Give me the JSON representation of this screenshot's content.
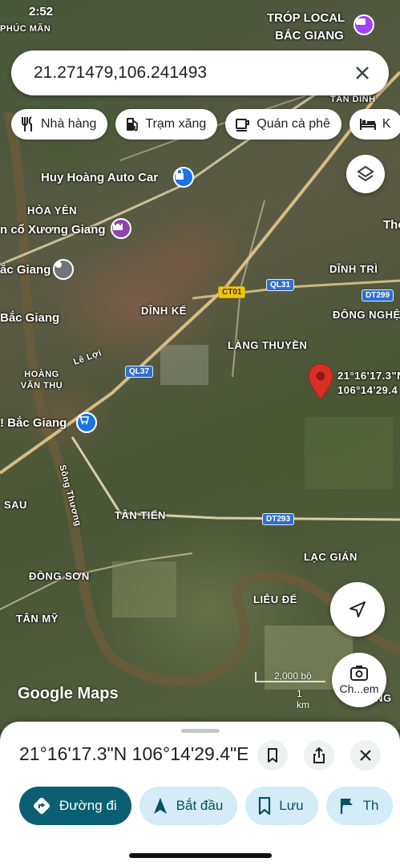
{
  "status": {
    "time": "2:52"
  },
  "search": {
    "query": "21.271479,106.241493"
  },
  "chips": [
    {
      "label": "Nhà hàng",
      "icon": "restaurant-icon"
    },
    {
      "label": "Trạm xăng",
      "icon": "gas-station-icon"
    },
    {
      "label": "Quán cà phê",
      "icon": "coffee-icon"
    },
    {
      "label": "K",
      "icon": "hotel-icon"
    }
  ],
  "map": {
    "labels": {
      "phuc_man": "PHÚC MÃN",
      "trop_local": "TRÓP LOCAL",
      "bac_giang_top": "BẮC GIANG",
      "tan_dinh": "TÂN DĨNH",
      "huy_hoang": "Huy Hoàng Auto Car",
      "hoa_yen": "HÒA YÊN",
      "xuong_giang": "n cổ Xương Giang",
      "tho": "Thọ",
      "bac_giang_city": "ắc Giang",
      "dinh_tri": "DĨNH TRÌ",
      "dinh_ke": "DĨNH KẾ",
      "dong_nghe": "ĐÔNG NGHỆ",
      "bac_giang_left": "Bắc Giang",
      "le_loi": "Lê Lợi",
      "lang_thuyen": "LÀNG THUYỀN",
      "hoang_van_thu": "HOÀNG VĂN THỤ",
      "bac_giang_market": "! Bắc Giang",
      "song_thuong": "Sông Thương",
      "sau": "SAU",
      "tan_tien": "TÂN TIẾN",
      "lac_gian": "LẠC GIÁN",
      "dong_son": "ĐỒNG SƠN",
      "lieu_de": "LIỄU ĐỂ",
      "tan_my": "TÂN MỸ",
      "trung": "TRUNG"
    },
    "shields": {
      "ct01": "CT01",
      "ql31": "QL31",
      "dt299": "DT299",
      "ql37": "QL37",
      "dt293": "DT293"
    },
    "pin_label_line1": "21°16'17.3\"N",
    "pin_label_line2": "106°14'29.4",
    "scale_text": "2,000 bộ",
    "scale_text2": "1 km",
    "brand": "Google Maps",
    "street_view_label": "Ch...em"
  },
  "sheet": {
    "title": "21°16'17.3\"N 106°14'29.4\"E",
    "actions": [
      {
        "label": "Đường đi",
        "icon": "directions-icon"
      },
      {
        "label": "Bắt đầu",
        "icon": "navigation-icon"
      },
      {
        "label": "Lưu",
        "icon": "bookmark-icon"
      },
      {
        "label": "Th",
        "icon": "flag-icon"
      }
    ]
  },
  "colors": {
    "accent": "#0b5f72",
    "pin": "#d93025",
    "chip_bg": "#ffffff"
  }
}
